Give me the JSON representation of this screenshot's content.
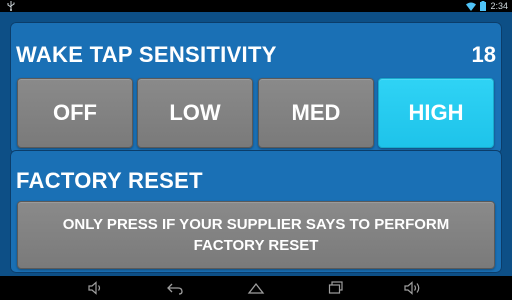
{
  "status_bar": {
    "time": "2:34",
    "icons": [
      "usb-icon",
      "wifi-icon",
      "battery-icon"
    ]
  },
  "wake_tap": {
    "title": "WAKE TAP SENSITIVITY",
    "value": "18",
    "options": [
      "OFF",
      "LOW",
      "MED",
      "HIGH"
    ],
    "selected": "HIGH"
  },
  "factory_reset": {
    "title": "FACTORY RESET",
    "button_label": "ONLY PRESS IF YOUR SUPPLIER SAYS TO PERFORM FACTORY RESET"
  },
  "nav_bar": {
    "icons": [
      "volume-down-icon",
      "back-icon",
      "home-icon",
      "recents-icon",
      "volume-up-icon"
    ]
  },
  "colors": {
    "background": "#0d4f86",
    "panel": "#1a70b5",
    "button": "#7f7f7f",
    "button_active": "#26cbef"
  }
}
